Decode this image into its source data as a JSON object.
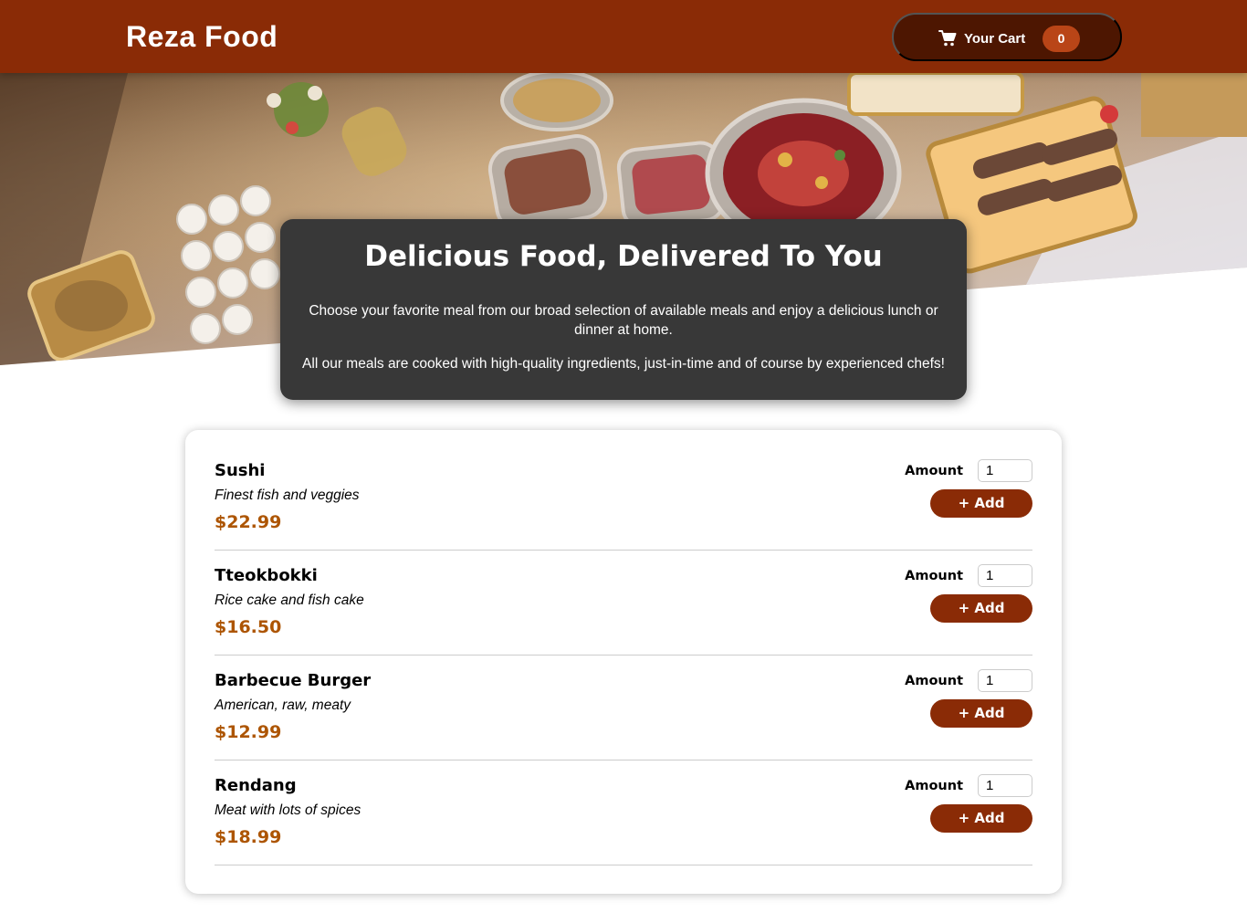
{
  "header": {
    "brand": "Reza Food",
    "cart_label": "Your Cart",
    "cart_count": "0",
    "cart_icon": "shopping-cart-icon"
  },
  "hero": {
    "image": "buffet-food-table-photo"
  },
  "summary": {
    "title": "Delicious Food, Delivered To You",
    "paragraph1": "Choose your favorite meal from our broad selection of available meals and enjoy a delicious lunch or dinner at home.",
    "paragraph2": "All our meals are cooked with high-quality ingredients, just-in-time and of course by experienced chefs!"
  },
  "meals": [
    {
      "name": "Sushi",
      "description": "Finest fish and veggies",
      "price": "$22.99",
      "amount_label": "Amount",
      "amount_value": "1",
      "add_label": "+ Add"
    },
    {
      "name": "Tteokbokki",
      "description": "Rice cake and fish cake",
      "price": "$16.50",
      "amount_label": "Amount",
      "amount_value": "1",
      "add_label": "+ Add"
    },
    {
      "name": "Barbecue Burger",
      "description": "American, raw, meaty",
      "price": "$12.99",
      "amount_label": "Amount",
      "amount_value": "1",
      "add_label": "+ Add"
    },
    {
      "name": "Rendang",
      "description": "Meat with lots of spices",
      "price": "$18.99",
      "amount_label": "Amount",
      "amount_value": "1",
      "add_label": "+ Add"
    }
  ],
  "colors": {
    "header": "#8a2b06",
    "cart_button": "#4d1601",
    "cart_badge": "#b94517",
    "summary_bg": "#383838",
    "price": "#ad5502",
    "add_button": "#8a2b06"
  }
}
